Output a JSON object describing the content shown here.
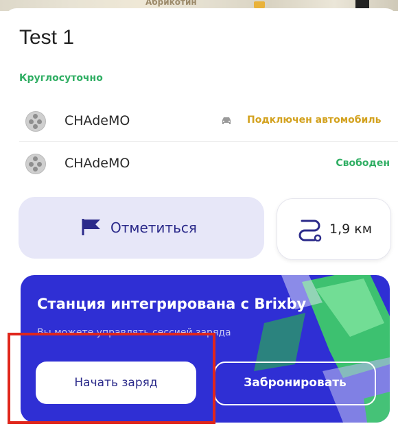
{
  "map": {
    "partial_label": "Абрикотин"
  },
  "station": {
    "title": "Test 1",
    "hours": "Круглосуточно"
  },
  "connectors": [
    {
      "name": "CHAdeMO",
      "status": "Подключен автомобиль",
      "status_color": "#d3a21f",
      "icon": "plug-icon",
      "status_icon": "car-icon"
    },
    {
      "name": "CHAdeMO",
      "status": "Свободен",
      "status_color": "#2fae63",
      "icon": "plug-icon"
    }
  ],
  "actions": {
    "checkin_label": "Отметиться",
    "checkin_icon": "flag-icon",
    "distance": "1,9 км",
    "distance_icon": "route-icon"
  },
  "promo": {
    "title": "Станция интегрирована с Brixby",
    "subtitle": "Вы можете управлять сессией заряда",
    "start_label": "Начать заряд",
    "book_label": "Забронировать",
    "background_color": "#2f2fd4"
  },
  "annotation": {
    "highlight_color": "#e0261c"
  }
}
